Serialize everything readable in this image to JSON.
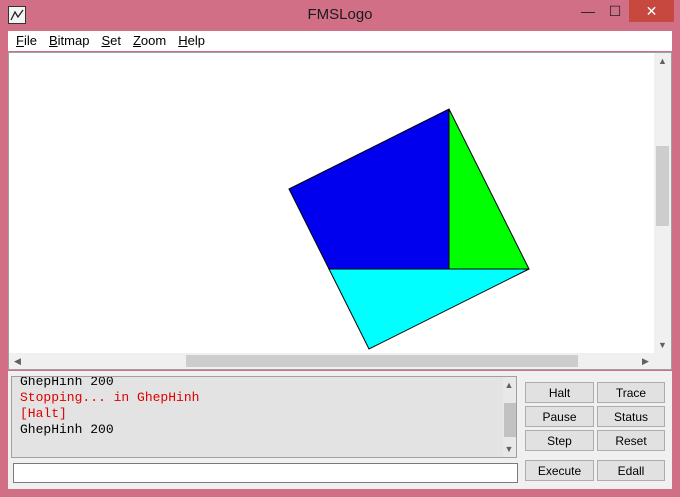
{
  "window": {
    "title": "FMSLogo"
  },
  "titlebar_buttons": {
    "minimize": "—",
    "maximize": "☐",
    "close": "✕"
  },
  "menu": [
    {
      "accel": "F",
      "rest": "ile"
    },
    {
      "accel": "B",
      "rest": "itmap"
    },
    {
      "accel": "S",
      "rest": "et"
    },
    {
      "accel": "Z",
      "rest": "oom"
    },
    {
      "accel": "H",
      "rest": "elp"
    }
  ],
  "scroll_arrows": {
    "up": "▲",
    "down": "▼",
    "left": "◀",
    "right": "▶"
  },
  "drawing": {
    "shapes": [
      {
        "name": "blue-square",
        "color": "#0000ee"
      },
      {
        "name": "green-triangle",
        "color": "#00ff00"
      },
      {
        "name": "cyan-triangle",
        "color": "#00ffff"
      }
    ]
  },
  "commander": {
    "history": [
      {
        "text": "GhepHinh 200",
        "color": "#000000"
      },
      {
        "text": "Stopping... in GhepHinh",
        "color": "#e00000"
      },
      {
        "text": "[Halt]",
        "color": "#e00000"
      },
      {
        "text": "GhepHinh 200",
        "color": "#000000"
      }
    ],
    "input_value": "",
    "buttons": {
      "halt": "Halt",
      "trace": "Trace",
      "pause": "Pause",
      "status": "Status",
      "step": "Step",
      "reset": "Reset",
      "execute": "Execute",
      "edall": "Edall"
    }
  }
}
